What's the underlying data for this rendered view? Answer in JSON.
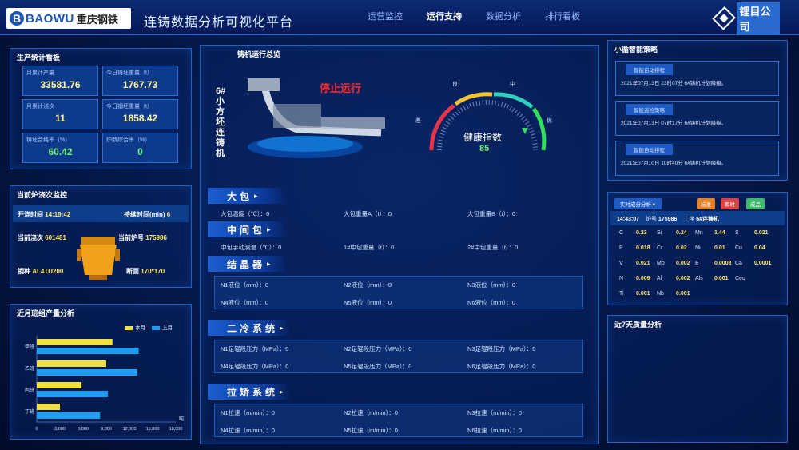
{
  "header": {
    "logo_letter": "B",
    "logo_text": "BAOWU",
    "logo_cn": "重庆钢铁",
    "title": "连铸数据分析可视化平台",
    "nav": [
      "运营监控",
      "运行支持",
      "数据分析",
      "排行看板"
    ],
    "brand": "锂目公司"
  },
  "stats": {
    "title": "生产统计看板",
    "items": [
      {
        "label": "月累计产量",
        "value": "33581.76"
      },
      {
        "label": "今日铸坯重量（t）",
        "value": "1767.73"
      },
      {
        "label": "月累计浇次",
        "value": "11"
      },
      {
        "label": "今日钢坯重量（t）",
        "value": "1858.42"
      },
      {
        "label": "铸坯合格率（%）",
        "value": "60.42"
      },
      {
        "label": "炉数综合率（%）",
        "value": "0"
      }
    ]
  },
  "heat": {
    "title": "当前炉浇次监控",
    "open_label": "开浇时间",
    "open_value": "14:19:42",
    "dur_label": "持续时间(min)",
    "dur_value": "6",
    "cast_label": "当前浇次",
    "cast_value": "601481",
    "furnace_label": "当前炉号",
    "furnace_value": "175986",
    "grade_label": "钢种",
    "grade_value": "AL4TU200",
    "section_label": "断面",
    "section_value": "170*170"
  },
  "shift": {
    "title": "近月班组产量分析",
    "legend": [
      "本月",
      "上月"
    ],
    "unit": "吨"
  },
  "chart_data": {
    "type": "bar",
    "orientation": "horizontal",
    "categories": [
      "甲班",
      "乙班",
      "丙班",
      "丁班"
    ],
    "series": [
      {
        "name": "本月",
        "values": [
          9800,
          9000,
          5800,
          3000
        ],
        "color": "#f0e040"
      },
      {
        "name": "上月",
        "values": [
          13200,
          13000,
          9200,
          8200
        ],
        "color": "#1e9cf0"
      }
    ],
    "xlim": [
      0,
      18000
    ],
    "xticks": [
      "0",
      "3,000",
      "6,000",
      "9,000",
      "12,000",
      "15,000",
      "18,000"
    ],
    "xlabel": "吨"
  },
  "caster": {
    "title": "铸机运行总览",
    "machine_name": "6#小方坯连铸机",
    "status": "停止运行",
    "gauge_label": "健康指数",
    "gauge_value": "85",
    "gauge_marks": [
      "差",
      "良",
      "中",
      "优"
    ]
  },
  "sections": [
    {
      "title": "大包",
      "fields": [
        "大包温度（℃）：0",
        "大包重量A（t）：0",
        "大包重量B（t）：0"
      ]
    },
    {
      "title": "中间包",
      "fields": [
        "中包手动测温（℃）：0",
        "1#中包重量（t）：0",
        "2#中包重量（t）：0"
      ]
    },
    {
      "title": "结晶器",
      "fields": [
        "N1液位（mm）：0",
        "N2液位（mm）：0",
        "N3液位（mm）：0",
        "N4液位（mm）：0",
        "N5液位（mm）：0",
        "N6液位（mm）：0"
      ]
    },
    {
      "title": "二冷系统",
      "fields": [
        "N1足辊段压力（MPa）：0",
        "N2足辊段压力（MPa）：0",
        "N3足辊段压力（MPa）：0",
        "N4足辊段压力（MPa）：0",
        "N5足辊段压力（MPa）：0",
        "N6足辊段压力（MPa）：0"
      ]
    },
    {
      "title": "拉矫系统",
      "fields": [
        "N1拉速（m/min）：0",
        "N2拉速（m/min）：0",
        "N3拉速（m/min）：0",
        "N4拉速（m/min）：0",
        "N5拉速（m/min）：0",
        "N6拉速（m/min）：0"
      ]
    }
  ],
  "alerts": {
    "title": "小循智能策略",
    "items": [
      {
        "tag": "智能自动排程",
        "msg": "2021年07月13日 23时07分 6#铸机计划降级。"
      },
      {
        "tag": "智能巡检策略",
        "msg": "2021年07月13日 07时17分 6#铸机计划降级。"
      },
      {
        "tag": "智能自动排程",
        "msg": "2021年07月10日 10时40分 6#铸机计划降级。"
      }
    ]
  },
  "composition": {
    "select": "实时成分分析",
    "buttons": [
      "标准",
      "即时",
      "成品"
    ],
    "time": "14:43:07",
    "furnace_label": "炉号",
    "furnace": "175986",
    "proc_label": "工序",
    "proc": "6#连铸机",
    "elements": [
      [
        "C",
        "0.23",
        "Si",
        "0.24",
        "Mn",
        "1.44",
        "S",
        "0.021"
      ],
      [
        "P",
        "0.018",
        "Cr",
        "0.02",
        "Ni",
        "0.01",
        "Cu",
        "0.04"
      ],
      [
        "V",
        "0.021",
        "Mo",
        "0.002",
        "B",
        "0.0008",
        "Ca",
        "0.0001"
      ],
      [
        "N",
        "0.009",
        "Al",
        "0.002",
        "Als",
        "0.001",
        "Ceq",
        ""
      ],
      [
        "Ti",
        "0.001",
        "Nb",
        "0.001",
        "",
        "",
        "",
        ""
      ]
    ]
  },
  "quality": {
    "title": "近7天质量分析"
  }
}
